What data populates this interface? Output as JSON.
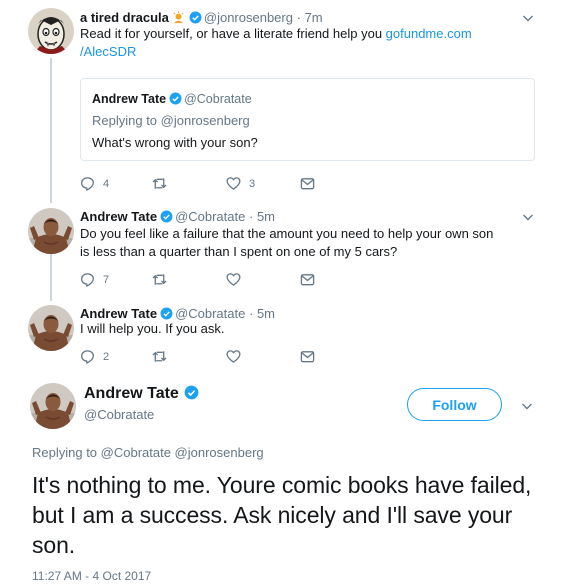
{
  "tweets": [
    {
      "name": "a tired dracula",
      "handle": "@jonrosenberg",
      "dot": "·",
      "time": "7m",
      "text_line1_prefix": "Read it for yourself, or have a literate friend help you ",
      "link_line1": "gofundme.com",
      "link_line2": "/AlecSDR",
      "quote": {
        "name": "Andrew Tate",
        "handle": "@Cobratate",
        "replying_to": "Replying to @jonrosenberg",
        "text": "What's wrong with your son?"
      },
      "reply_count": "4",
      "retweet_count": "",
      "like_count": "3"
    },
    {
      "name": "Andrew Tate",
      "handle": "@Cobratate",
      "dot": "·",
      "time": "5m",
      "text_line1": "Do you feel like a failure that the amount you need to help your own son",
      "text_line2": "is less than a quarter than I spent on one of my 5 cars?",
      "reply_count": "7",
      "retweet_count": "",
      "like_count": ""
    },
    {
      "name": "Andrew Tate",
      "handle": "@Cobratate",
      "dot": "·",
      "time": "5m",
      "text": "I will help you. If you ask.",
      "reply_count": "2",
      "retweet_count": "",
      "like_count": ""
    }
  ],
  "focused": {
    "name": "Andrew Tate",
    "handle": "@Cobratate",
    "follow_label": "Follow",
    "replying_to": "Replying to @Cobratate @jonrosenberg",
    "text": "It's nothing to me. Youre comic books have failed, but I am a success. Ask nicely and I'll save your son.",
    "timestamp": "11:27 AM - 4 Oct 2017"
  },
  "icons": {
    "reply": "reply-icon",
    "retweet": "retweet-icon",
    "like": "heart-icon",
    "message": "envelope-icon",
    "more": "chevron-down-icon",
    "verified": "verified-badge-icon",
    "emoji": "sun-emoji-icon"
  },
  "colors": {
    "text": "#14171a",
    "muted": "#657786",
    "link": "#1b95e0",
    "accent": "#1da1f2",
    "border": "#e1e8ed",
    "thread_line": "#ccd6dd"
  }
}
